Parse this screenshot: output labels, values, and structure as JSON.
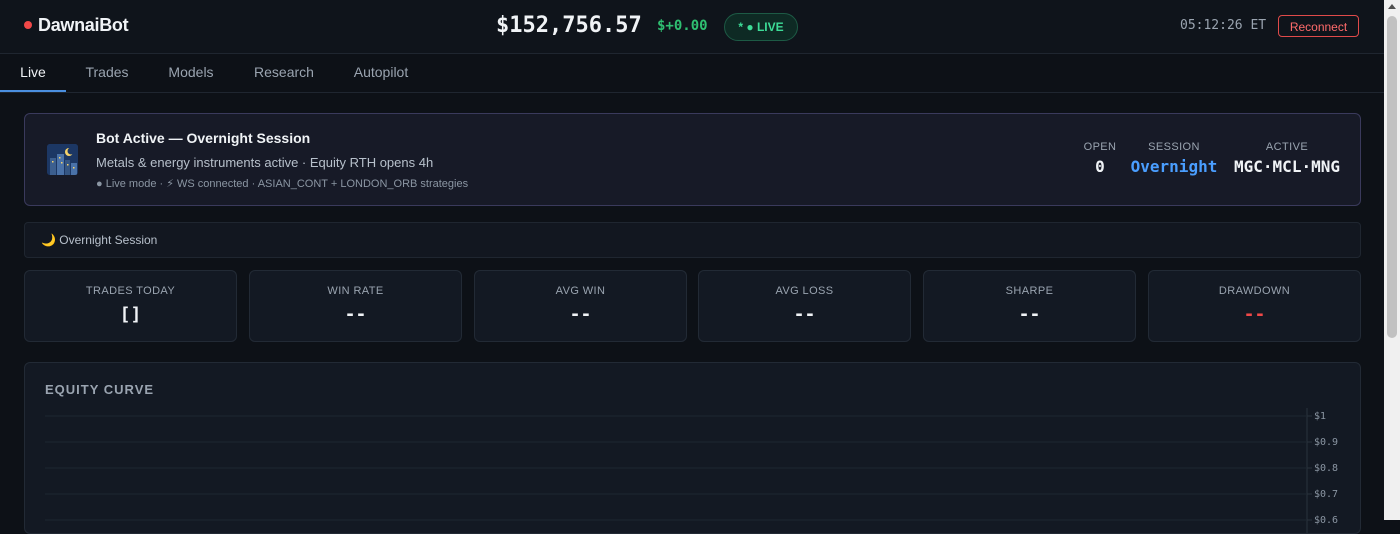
{
  "header": {
    "brand": "DawnaiBot",
    "balance": "$152,756.57",
    "pnl": "$+0.00",
    "live_badge": "* ● LIVE",
    "clock": "05:12:26 ET",
    "reconnect_label": "Reconnect"
  },
  "tabs": [
    {
      "label": "Live",
      "active": true
    },
    {
      "label": "Trades",
      "active": false
    },
    {
      "label": "Models",
      "active": false
    },
    {
      "label": "Research",
      "active": false
    },
    {
      "label": "Autopilot",
      "active": false
    }
  ],
  "status_panel": {
    "title": "Bot Active — Overnight Session",
    "subtitle": "Metals & energy instruments active · Equity RTH opens 4h",
    "meta": "● Live mode  ·  ⚡ WS connected  ·  ASIAN_CONT + LONDON_ORB strategies",
    "open_label": "OPEN",
    "open_value": "0",
    "session_label": "SESSION",
    "session_value": "Overnight",
    "active_label": "ACTIVE",
    "active_value": "MGC·MCL·MNG"
  },
  "session_bar": {
    "label": "🌙 Overnight Session"
  },
  "stats": [
    {
      "label": "TRADES TODAY",
      "value": "[]",
      "color": "#f0f3f6"
    },
    {
      "label": "WIN RATE",
      "value": "--",
      "color": "#f0f3f6"
    },
    {
      "label": "AVG WIN",
      "value": "--",
      "color": "#f0f3f6"
    },
    {
      "label": "AVG LOSS",
      "value": "--",
      "color": "#f0f3f6"
    },
    {
      "label": "SHARPE",
      "value": "--",
      "color": "#f0f3f6"
    },
    {
      "label": "DRAWDOWN",
      "value": "--",
      "color": "#f04848"
    }
  ],
  "equity_chart": {
    "title": "EQUITY CURVE",
    "chart_data": {
      "type": "line",
      "title": "EQUITY CURVE",
      "series": [],
      "y_ticks": [
        "$1",
        "$0.9",
        "$0.8",
        "$0.7",
        "$0.6"
      ],
      "ylim": [
        0,
        1
      ],
      "grid": true
    }
  },
  "colors": {
    "accent": "#4a8fe0",
    "live_green": "#3ddc97",
    "danger": "#f04848",
    "session_blue": "#4a9eff"
  }
}
